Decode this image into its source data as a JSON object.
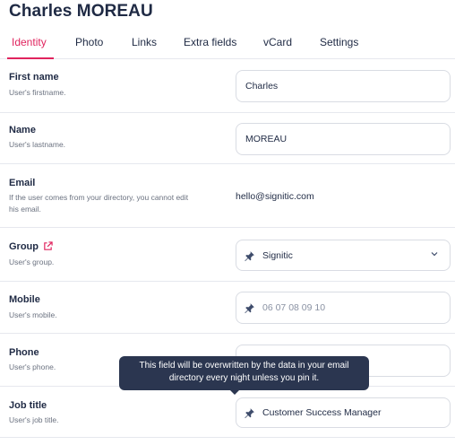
{
  "page": {
    "title": "Charles MOREAU"
  },
  "tabs": [
    {
      "label": "Identity",
      "active": true
    },
    {
      "label": "Photo"
    },
    {
      "label": "Links"
    },
    {
      "label": "Extra fields"
    },
    {
      "label": "vCard"
    },
    {
      "label": "Settings"
    }
  ],
  "fields": {
    "first_name": {
      "label": "First name",
      "description": "User's firstname.",
      "value": "Charles"
    },
    "name": {
      "label": "Name",
      "description": "User's lastname.",
      "value": "MOREAU"
    },
    "email": {
      "label": "Email",
      "description_line1": "If the user comes from your directory, you cannot edit",
      "description_line2": "his email.",
      "value": "hello@signitic.com"
    },
    "group": {
      "label": "Group",
      "description": "User's group.",
      "value": "Signitic"
    },
    "mobile": {
      "label": "Mobile",
      "description": "User's mobile.",
      "placeholder": "06 07 08 09 10"
    },
    "phone": {
      "label": "Phone",
      "description": "User's phone.",
      "value": ""
    },
    "job_title": {
      "label": "Job title",
      "description": "User's job title.",
      "value": "Customer Success Manager"
    }
  },
  "tooltip": {
    "line1": "This field will be overwritten by the data in your email",
    "line2": "directory every night unless you pin it."
  },
  "colors": {
    "accent": "#e0245e",
    "text": "#1f2a44",
    "tooltip_bg": "#2b3650",
    "border": "#d9dce3"
  },
  "icons": {
    "pin": "pin-icon",
    "chevron": "chevron-down-icon",
    "external": "external-link-icon"
  }
}
